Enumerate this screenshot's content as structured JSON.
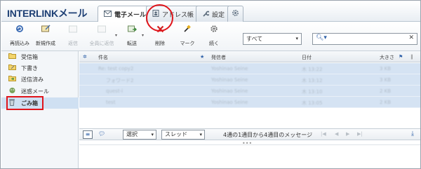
{
  "app": {
    "logo": "INTERLINKメール"
  },
  "tabs": [
    {
      "label": "電子メール",
      "icon": "envelope-icon",
      "active": true
    },
    {
      "label": "アドレス帳",
      "icon": "address-book-icon"
    },
    {
      "label": "設定",
      "icon": "wrench-icon"
    },
    {
      "label": "",
      "icon": "gear-icon"
    }
  ],
  "toolbar": {
    "buttons": [
      {
        "label": "再読込み",
        "icon": "refresh-icon"
      },
      {
        "label": "新規作成",
        "icon": "compose-icon"
      },
      {
        "label": "返信",
        "icon": "reply-icon",
        "disabled": true
      },
      {
        "label": "全員に返信",
        "icon": "reply-all-icon",
        "disabled": true
      },
      {
        "label": "転送",
        "icon": "forward-icon"
      },
      {
        "label": "削除",
        "icon": "delete-icon"
      },
      {
        "label": "マーク",
        "icon": "mark-icon"
      },
      {
        "label": "続く",
        "icon": "more-icon"
      }
    ],
    "filter_value": "すべて",
    "search_placeholder": ""
  },
  "folders": [
    {
      "label": "受信箱",
      "icon": "inbox-icon"
    },
    {
      "label": "下書き",
      "icon": "drafts-icon"
    },
    {
      "label": "送信済み",
      "icon": "sent-icon"
    },
    {
      "label": "迷惑メール",
      "icon": "junk-icon"
    },
    {
      "label": "ごみ箱",
      "icon": "trash-icon",
      "selected": true
    }
  ],
  "list": {
    "headers": {
      "subject": "件名",
      "from": "発信者",
      "date": "日付",
      "size": "大きさ"
    },
    "rows": [
      {
        "subject": "Re: test copy2",
        "from": "Yoshinao Seine",
        "date": "木 13:22",
        "size": "3 KB"
      },
      {
        "subject": "フォワード2",
        "from": "Yoshinao Seine",
        "date": "木 13:12",
        "size": "3 KB"
      },
      {
        "subject": "quest-i",
        "from": "Yoshinao Seine",
        "date": "木 13:10",
        "size": "2 KB"
      },
      {
        "subject": "test",
        "from": "Yoshinao Seine",
        "date": "木 13:05",
        "size": "2 KB"
      }
    ]
  },
  "pager": {
    "select_label": "選択",
    "thread_label": "スレッド",
    "status": "4通の1通目から4通目のメッセージ"
  },
  "colors": {
    "accent": "#2f61a8",
    "highlight": "#e0151b",
    "selection": "#d5e3f3"
  }
}
